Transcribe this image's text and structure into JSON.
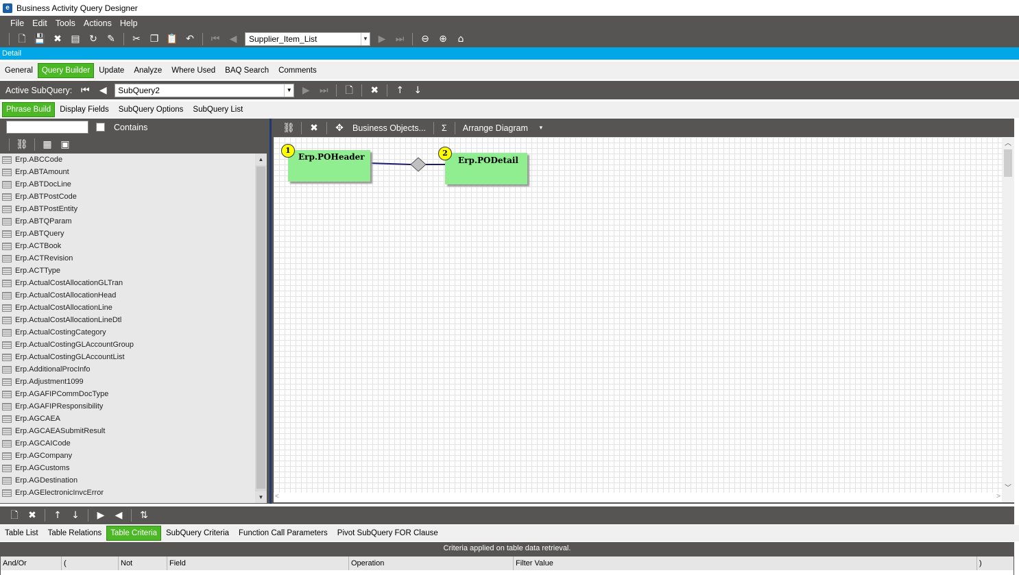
{
  "window": {
    "title": "Business Activity Query Designer"
  },
  "menu": [
    "File",
    "Edit",
    "Tools",
    "Actions",
    "Help"
  ],
  "toolbar": {
    "query_value": "Supplier_Item_List"
  },
  "detail_label": "Detail",
  "main_tabs": [
    "General",
    "Query Builder",
    "Update",
    "Analyze",
    "Where Used",
    "BAQ Search",
    "Comments"
  ],
  "subquery": {
    "label": "Active SubQuery:",
    "value": "SubQuery2"
  },
  "sub_tabs": [
    "Phrase Build",
    "Display Fields",
    "SubQuery Options",
    "SubQuery List"
  ],
  "search": {
    "contains_label": "Contains",
    "value": ""
  },
  "table_list": [
    "Erp.ABCCode",
    "Erp.ABTAmount",
    "Erp.ABTDocLine",
    "Erp.ABTPostCode",
    "Erp.ABTPostEntity",
    "Erp.ABTQParam",
    "Erp.ABTQuery",
    "Erp.ACTBook",
    "Erp.ACTRevision",
    "Erp.ACTType",
    "Erp.ActualCostAllocationGLTran",
    "Erp.ActualCostAllocationHead",
    "Erp.ActualCostAllocationLine",
    "Erp.ActualCostAllocationLineDtl",
    "Erp.ActualCostingCategory",
    "Erp.ActualCostingGLAccountGroup",
    "Erp.ActualCostingGLAccountList",
    "Erp.AdditionalProcInfo",
    "Erp.Adjustment1099",
    "Erp.AGAFIPCommDocType",
    "Erp.AGAFIPResponsibility",
    "Erp.AGCAEA",
    "Erp.AGCAEASubmitResult",
    "Erp.AGCAICode",
    "Erp.AGCompany",
    "Erp.AGCustoms",
    "Erp.AGDestination",
    "Erp.AGElectronicInvcError"
  ],
  "diagram_toolbar": {
    "business_objects": "Business Objects...",
    "sigma": "Σ",
    "arrange": "Arrange Diagram"
  },
  "diagram": {
    "tables": [
      {
        "number": "1",
        "name": "Erp.POHeader"
      },
      {
        "number": "2",
        "name": "Erp.PODetail"
      }
    ],
    "box_color": "#90ee90",
    "badge_color": "#ffff00"
  },
  "bottom_tabs": [
    "Table List",
    "Table Relations",
    "Table Criteria",
    "SubQuery Criteria",
    "Function Call Parameters",
    "Pivot SubQuery FOR Clause"
  ],
  "criteria": {
    "note": "Criteria applied on  table data retrieval.",
    "columns": [
      "And/Or",
      "(",
      "Not",
      "Field",
      "Operation",
      "Filter Value",
      ")"
    ]
  },
  "colors": {
    "accent": "#00a8e8",
    "active_tab": "#4cb826",
    "panel": "#575553"
  }
}
